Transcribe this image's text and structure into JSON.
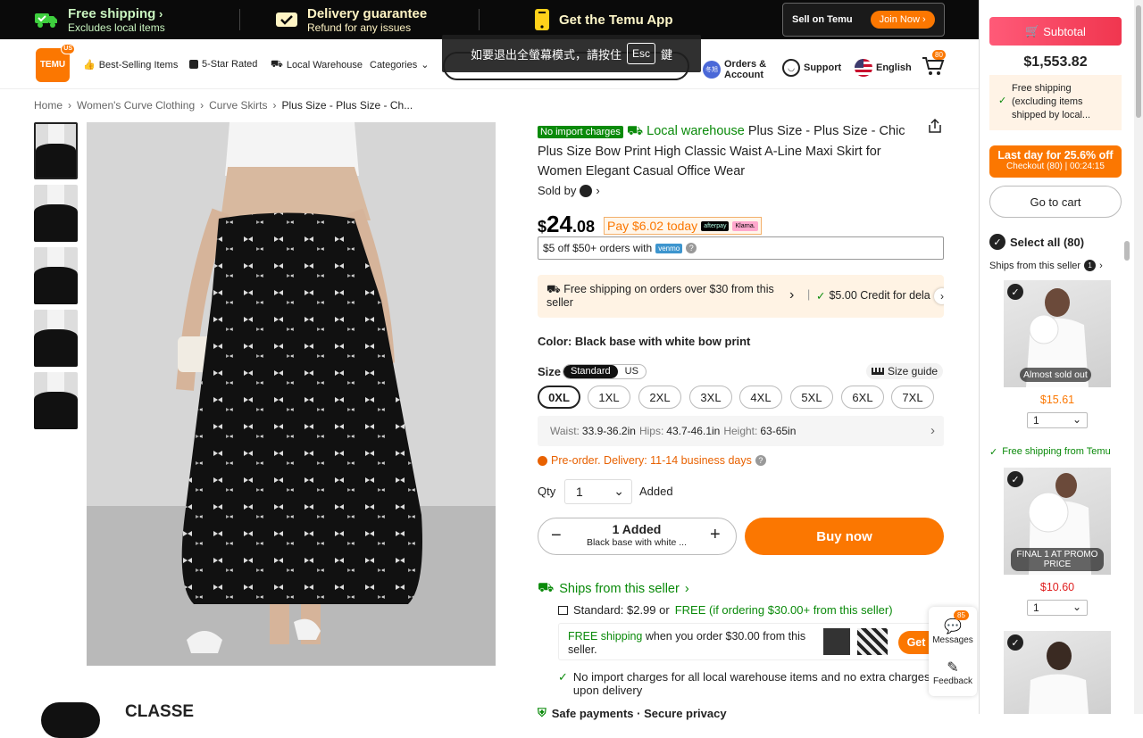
{
  "topbar": {
    "free_shipping_title": "Free shipping",
    "free_shipping_sub": "Excludes local items",
    "delivery_title": "Delivery guarantee",
    "delivery_sub": "Refund for any issues",
    "app_title": "Get the Temu App",
    "sell_label": "Sell on Temu",
    "join_label": "Join Now"
  },
  "header": {
    "logo_text": "TEMU",
    "logo_badge": "US",
    "nav": [
      "Best-Selling Items",
      "5-Star Rated",
      "Local Warehouse",
      "Categories"
    ],
    "orders_label_1": "Orders &",
    "orders_label_2": "Account",
    "avatar_text": "冬旭",
    "support_label": "Support",
    "language_label": "English",
    "cart_count": "80"
  },
  "fullscreen_tooltip": {
    "text_before": "如要退出全螢幕模式，請按住",
    "key": "Esc",
    "text_after": "鍵"
  },
  "breadcrumb": [
    "Home",
    "Women's Curve Clothing",
    "Curve Skirts",
    "Plus Size - Plus Size - Ch..."
  ],
  "product": {
    "badge": "No import charges",
    "warehouse": "Local warehouse",
    "title": "Plus Size - Plus Size - Chic Plus Size Bow Print High Classic Waist A-Line Maxi Skirt for Women Elegant Casual Office Wear",
    "sold_by": "Sold by",
    "price_currency": "$",
    "price_int": "24",
    "price_dec": ".08",
    "pay_today": "Pay $6.02 today",
    "afterpay": "afterpay",
    "klarna": "Klarna.",
    "venmo_text": "$5 off $50+ orders with",
    "venmo_logo": "venmo",
    "ship_banner_1": "Free shipping on orders over $30 from this",
    "ship_banner_2": "seller",
    "credit_text": "$5.00 Credit for dela",
    "color_label": "Color:",
    "color_value": "Black base with white bow print",
    "size_label": "Size",
    "size_standard": "Standard",
    "size_us": "US",
    "size_guide": "Size guide",
    "sizes": [
      "0XL",
      "1XL",
      "2XL",
      "3XL",
      "4XL",
      "5XL",
      "6XL",
      "7XL"
    ],
    "selected_size": "0XL",
    "waist_label": "Waist:",
    "waist_value": "33.9-36.2in",
    "hips_label": "Hips:",
    "hips_value": "43.7-46.1in",
    "height_label": "Height:",
    "height_value": "63-65in",
    "preorder": "Pre-order. Delivery: 11-14 business days",
    "qty_label": "Qty",
    "qty_value": "1",
    "added_label": "Added",
    "stepper_title": "1 Added",
    "stepper_sub": "Black base with white ...",
    "buy_now": "Buy now",
    "ships_from": "Ships from this seller",
    "standard_ship_prefix": "Standard: $2.99 or",
    "standard_ship_free": "FREE (if ordering $30.00+ from this seller)",
    "free_box_green": "FREE shipping",
    "free_box_text": "when you order $30.00 from this",
    "free_box_text2": "seller.",
    "get_label": "Get",
    "no_import_1": "No import charges for all local warehouse items and no extra charges",
    "no_import_2": "upon delivery",
    "safe_pay": "Safe payments · Secure privacy",
    "store_name": "CLASSE"
  },
  "floating": {
    "messages_label": "Messages",
    "messages_count": "85",
    "feedback_label": "Feedback"
  },
  "cart": {
    "subtotal_label": "Subtotal",
    "subtotal_count": "80",
    "subtotal_value": "$1,553.82",
    "free_ship_1": "Free shipping",
    "free_ship_2": "(excluding items",
    "free_ship_3": "shipped by local...",
    "lastday_title": "Last day for 25.6% off",
    "lastday_sub": "Checkout (80) | 00:24:15",
    "go_to_cart": "Go to cart",
    "select_all": "Select all (80)",
    "ships_seller": "Ships from this seller",
    "seller_count": "1",
    "items": [
      {
        "badge": "Almost sold out",
        "price": "$15.61",
        "qty": "1"
      },
      {
        "badge": "FINAL 1 AT PROMO PRICE",
        "price": "$10.60",
        "qty": "1"
      }
    ],
    "free_from_temu": "Free shipping from Temu"
  }
}
